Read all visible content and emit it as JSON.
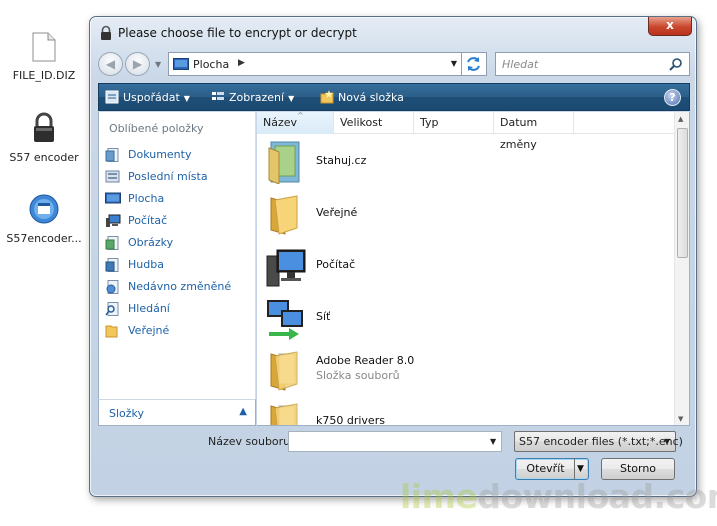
{
  "desktop": {
    "icons": [
      {
        "label": "FILE_ID.DIZ",
        "icon": "document-icon"
      },
      {
        "label": "S57 encoder",
        "icon": "padlock-icon"
      },
      {
        "label": "S57encoder...",
        "icon": "installer-icon"
      }
    ]
  },
  "dialog": {
    "title": "Please choose file to encrypt or decrypt",
    "close_label": "x",
    "address": {
      "location": "Plocha",
      "separator": "▶"
    },
    "search": {
      "placeholder": "Hledat"
    },
    "toolbar": {
      "organize": "Uspořádat",
      "views": "Zobrazení",
      "new_folder": "Nová složka",
      "help": "?"
    },
    "favorites": {
      "heading": "Oblíbené položky",
      "items": [
        {
          "label": "Dokumenty",
          "icon": "documents-icon"
        },
        {
          "label": "Poslední místa",
          "icon": "recent-places-icon"
        },
        {
          "label": "Plocha",
          "icon": "desktop-icon"
        },
        {
          "label": "Počítač",
          "icon": "computer-icon"
        },
        {
          "label": "Obrázky",
          "icon": "pictures-icon"
        },
        {
          "label": "Hudba",
          "icon": "music-icon"
        },
        {
          "label": "Nedávno změněné",
          "icon": "recently-changed-icon"
        },
        {
          "label": "Hledání",
          "icon": "searches-icon"
        },
        {
          "label": "Veřejné",
          "icon": "public-folder-icon"
        }
      ],
      "folders_label": "Složky",
      "folders_arrow": "▲"
    },
    "columns": [
      "Název",
      "Velikost",
      "Typ",
      "Datum změny"
    ],
    "files": [
      {
        "name": "Stahuj.cz",
        "sub": "",
        "icon": "user-folder-icon"
      },
      {
        "name": "Veřejné",
        "sub": "",
        "icon": "folder-icon"
      },
      {
        "name": "Počítač",
        "sub": "",
        "icon": "computer-icon"
      },
      {
        "name": "Síť",
        "sub": "",
        "icon": "network-icon"
      },
      {
        "name": "Adobe Reader 8.0",
        "sub": "Složka souborů",
        "icon": "folder-icon"
      },
      {
        "name": "k750 drivers",
        "sub": "",
        "icon": "folder-icon"
      }
    ],
    "filename_label": "Název souboru:",
    "filename_value": "",
    "filetype_value": "S57 encoder files (*.txt;*.enc)",
    "open_button": "Otevřít",
    "cancel_button": "Storno"
  },
  "watermark": {
    "part1": "lime",
    "part2": "download.com"
  }
}
